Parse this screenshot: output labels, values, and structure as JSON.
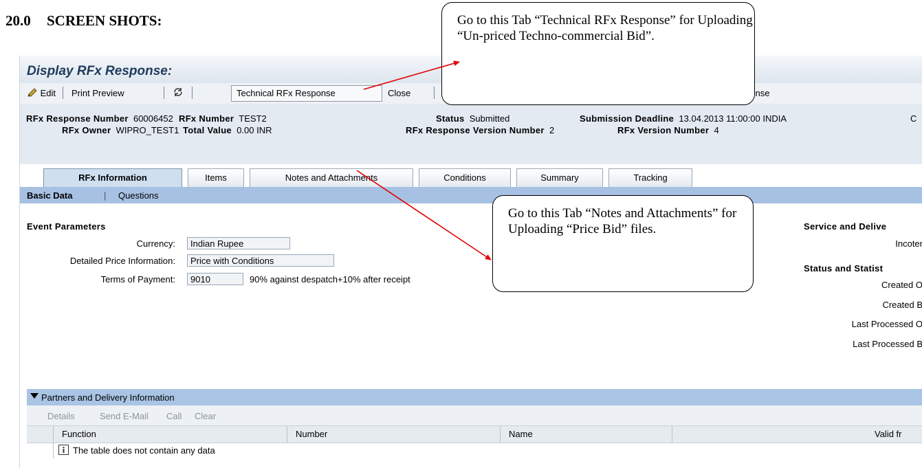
{
  "doc": {
    "section_number": "20.0",
    "section_title": "SCREEN SHOTS:"
  },
  "app": {
    "title": "Display RFx Response:"
  },
  "toolbar": {
    "edit_label": "Edit",
    "print_preview_label": "Print Preview",
    "technical_response_label": "Technical RFx Response",
    "close_label": "Close",
    "partial_right_label": "ponse"
  },
  "header": {
    "response_number_label": "RFx Response Number",
    "response_number_value": "60006452",
    "rfx_number_label": "RFx Number",
    "rfx_number_value": "TEST2",
    "status_label": "Status",
    "status_value": "Submitted",
    "deadline_label": "Submission Deadline",
    "deadline_value": "13.04.2013 11:00:00 INDIA",
    "cut_label": "C",
    "owner_label": "RFx Owner",
    "owner_value": "WIPRO_TEST1",
    "total_value_label": "Total Value",
    "total_value_value": "0.00 INR",
    "response_version_label": "RFx Response Version Number",
    "response_version_value": "2",
    "rfx_version_label": "RFx Version Number",
    "rfx_version_value": "4"
  },
  "tabs": [
    "RFx Information",
    "Items",
    "Notes and Attachments",
    "Conditions",
    "Summary",
    "Tracking"
  ],
  "subtabs": [
    "Basic Data",
    "Questions"
  ],
  "event_parameters": {
    "section_title": "Event Parameters",
    "currency_label": "Currency:",
    "currency_value": "Indian Rupee",
    "price_info_label": "Detailed Price Information:",
    "price_info_value": "Price with Conditions",
    "payment_label": "Terms of Payment:",
    "payment_code": "9010",
    "payment_text": "90% against despatch+10% after receipt"
  },
  "right_panel": {
    "service_title": "Service and Delive",
    "incoterms_label": "Incoter",
    "status_title": "Status and Statist",
    "created_on": "Created O",
    "created_by": "Created B",
    "last_processed_on": "Last Processed O",
    "last_processed_by": "Last Processed B"
  },
  "partners": {
    "title": "Partners and Delivery Information",
    "tools": [
      "Details",
      "Send E-Mail",
      "Call",
      "Clear"
    ],
    "columns": [
      "Function",
      "Number",
      "Name",
      "Valid fr"
    ],
    "empty_message": "The table does not contain any data"
  },
  "callouts": {
    "technical": "Go to this Tab “Technical RFx Response” for Uploading “Un-priced Techno-commercial Bid”.",
    "notes": "Go to this Tab “Notes and Attachments” for Uploading “Price Bid” files."
  },
  "colors": {
    "arrow": "#e00000",
    "title_text": "#1f3b5c",
    "subtab_bar": "#a7c1e2",
    "header_bg": "#e3eaf2"
  }
}
